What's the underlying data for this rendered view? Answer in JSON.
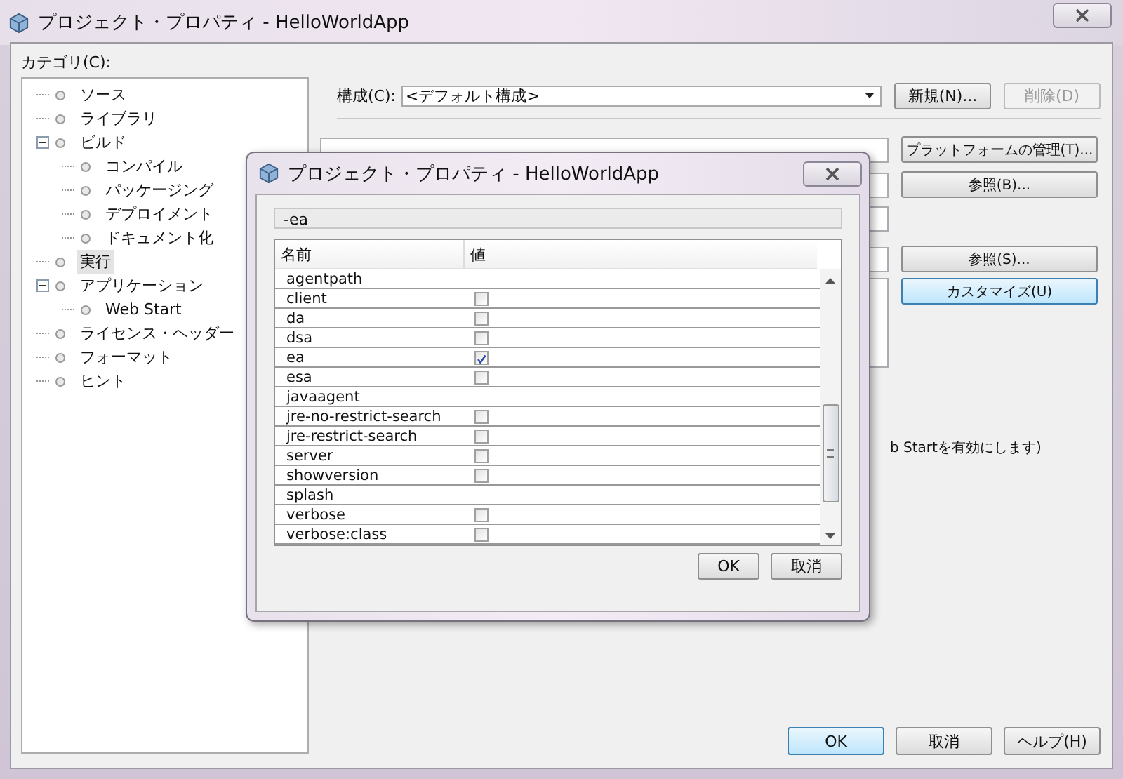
{
  "window": {
    "title": "プロジェクト・プロパティ - HelloWorldApp"
  },
  "categories": {
    "label": "カテゴリ(C):",
    "items": [
      {
        "label": "ソース",
        "selected": false
      },
      {
        "label": "ライブラリ",
        "selected": false
      },
      {
        "label": "ビルド",
        "selected": false,
        "expanded": true,
        "children": [
          {
            "label": "コンパイル",
            "selected": false
          },
          {
            "label": "パッケージング",
            "selected": false
          },
          {
            "label": "デプロイメント",
            "selected": false
          },
          {
            "label": "ドキュメント化",
            "selected": false
          }
        ]
      },
      {
        "label": "実行",
        "selected": true
      },
      {
        "label": "アプリケーション",
        "selected": false,
        "expanded": true,
        "children": [
          {
            "label": "Web Start",
            "selected": false
          }
        ]
      },
      {
        "label": "ライセンス・ヘッダー",
        "selected": false
      },
      {
        "label": "フォーマット",
        "selected": false
      },
      {
        "label": "ヒント",
        "selected": false
      }
    ]
  },
  "configuration": {
    "label": "構成(C):",
    "value": "<デフォルト構成>",
    "buttons": [
      {
        "label": "新規(N)...",
        "disabled": false
      },
      {
        "label": "削除(D)",
        "disabled": true
      }
    ]
  },
  "side_buttons": [
    {
      "label": "プラットフォームの管理(T)...",
      "focused": false
    },
    {
      "label": "参照(B)...",
      "focused": false
    },
    {
      "label": "参照(S)...",
      "focused": false
    },
    {
      "label": "カスタマイズ(U)",
      "focused": true
    }
  ],
  "partial_text": "b Startを有効にします)",
  "footer_buttons": [
    {
      "label": "OK",
      "default": true
    },
    {
      "label": "取消",
      "default": false
    },
    {
      "label": "ヘルプ(H)",
      "default": false
    }
  ],
  "dialog": {
    "title": "プロジェクト・プロパティ - HelloWorldApp",
    "value": "-ea",
    "columns": [
      "名前",
      "値"
    ],
    "rows": [
      {
        "name": "agentpath",
        "kind": "argument"
      },
      {
        "name": "client",
        "kind": "option",
        "checked": false
      },
      {
        "name": "da",
        "kind": "option",
        "checked": false
      },
      {
        "name": "dsa",
        "kind": "option",
        "checked": false
      },
      {
        "name": "ea",
        "kind": "option",
        "checked": true
      },
      {
        "name": "esa",
        "kind": "option",
        "checked": false
      },
      {
        "name": "javaagent",
        "kind": "argument"
      },
      {
        "name": "jre-no-restrict-search",
        "kind": "option",
        "checked": false
      },
      {
        "name": "jre-restrict-search",
        "kind": "option",
        "checked": false
      },
      {
        "name": "server",
        "kind": "option",
        "checked": false
      },
      {
        "name": "showversion",
        "kind": "option",
        "checked": false
      },
      {
        "name": "splash",
        "kind": "argument"
      },
      {
        "name": "verbose",
        "kind": "option",
        "checked": false
      },
      {
        "name": "verbose:class",
        "kind": "option",
        "checked": false
      }
    ],
    "buttons": [
      "OK",
      "取消"
    ]
  }
}
